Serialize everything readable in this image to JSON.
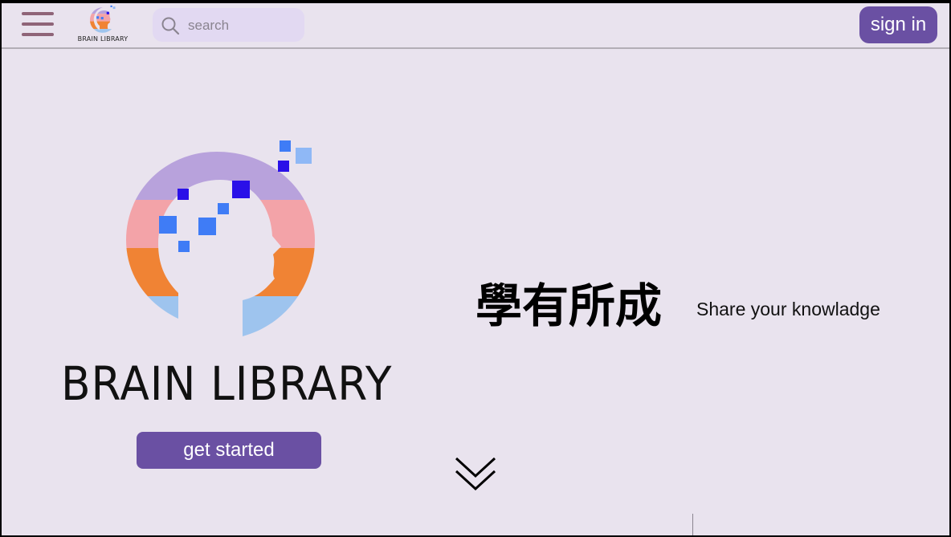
{
  "header": {
    "menu_icon": "hamburger-menu-icon",
    "logo_text": "BRAIN LIBRARY",
    "search": {
      "placeholder": "search",
      "value": "",
      "icon": "search-icon"
    },
    "signin_label": "sign in"
  },
  "hero": {
    "logo_title": "BRAIN LIBRARY",
    "get_started_label": "get started",
    "slogan": "學有所成",
    "tagline": "Share your knowladge",
    "scroll_icon": "double-chevron-down-icon"
  },
  "colors": {
    "background": "#e9e3ee",
    "accent": "#6a50a3",
    "menu_icon": "#8f6478",
    "search_bg": "#e2d9f2",
    "logo_band_1": "#b8a2dc",
    "logo_band_2": "#f3a3a8",
    "logo_band_3": "#f08334",
    "logo_band_4": "#9ec4ee",
    "pixel_dark": "#2a10e8",
    "pixel_mid": "#3f7cf6",
    "pixel_light": "#8fb8f6"
  }
}
